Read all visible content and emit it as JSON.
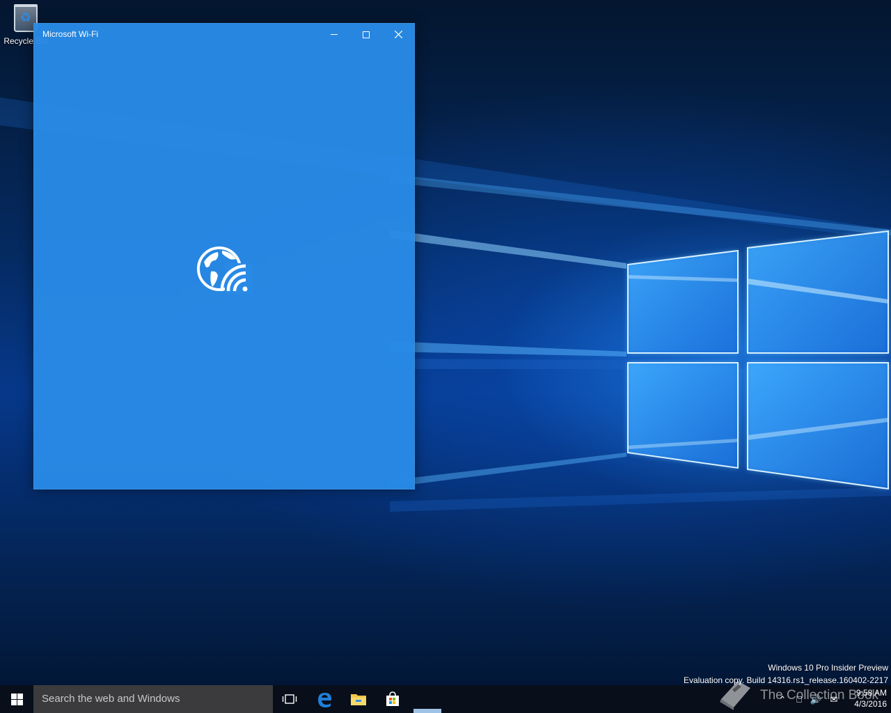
{
  "desktop": {
    "recycle_bin_label": "Recycle Bin",
    "wallpaper_accent": "#1e8cff"
  },
  "app_window": {
    "title": "Microsoft Wi-Fi",
    "background_color": "#298ae6",
    "splash_icon": "globe-wifi-icon",
    "controls": {
      "minimize": "minimize-icon",
      "maximize": "maximize-icon",
      "close": "close-icon"
    }
  },
  "taskbar": {
    "search_placeholder": "Search the web and Windows",
    "pinned": [
      "task-view-icon",
      "edge-icon",
      "file-explorer-icon",
      "store-icon"
    ],
    "clock": {
      "time": "9:58 AM",
      "date": "4/3/2016"
    }
  },
  "watermark": {
    "line1": "Windows 10 Pro Insider Preview",
    "line2": "Evaluation copy. Build 14316.rs1_release.160402-2217"
  },
  "overlay_logo": {
    "text": "The Collection Book"
  }
}
